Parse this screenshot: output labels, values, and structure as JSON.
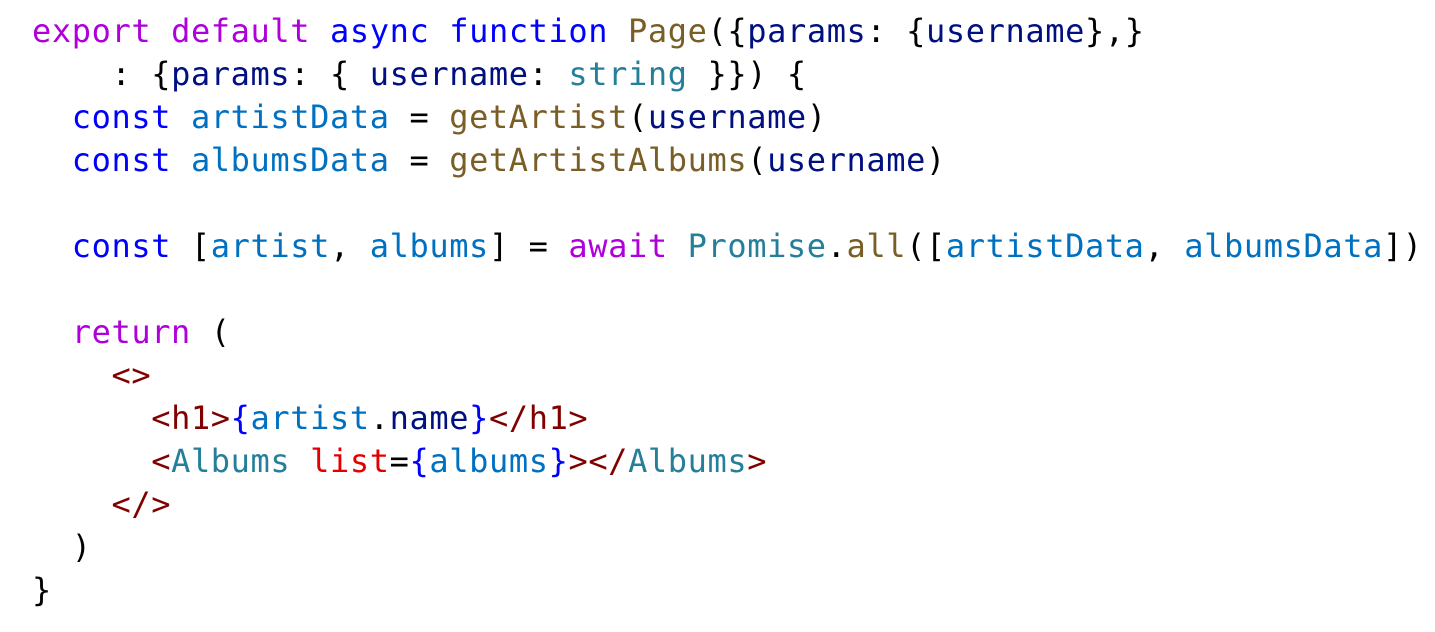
{
  "code": {
    "language": "tsx",
    "colors": {
      "kw": "#af00db",
      "st": "#0000ff",
      "fn": "#795e26",
      "pr": "#001080",
      "ty": "#267f99",
      "vr": "#0070c1",
      "tg": "#800000",
      "at": "#e50000",
      "br": "#0000ff",
      "pl": "#000000"
    },
    "lines": [
      {
        "tokens": [
          {
            "t": "export",
            "c": "kw"
          },
          {
            "t": " ",
            "c": "pl"
          },
          {
            "t": "default",
            "c": "kw"
          },
          {
            "t": " ",
            "c": "pl"
          },
          {
            "t": "async",
            "c": "st"
          },
          {
            "t": " ",
            "c": "pl"
          },
          {
            "t": "function",
            "c": "st"
          },
          {
            "t": " ",
            "c": "pl"
          },
          {
            "t": "Page",
            "c": "fn"
          },
          {
            "t": "({",
            "c": "pl"
          },
          {
            "t": "params",
            "c": "pr"
          },
          {
            "t": ": {",
            "c": "pl"
          },
          {
            "t": "username",
            "c": "pr"
          },
          {
            "t": "},}",
            "c": "pl"
          }
        ]
      },
      {
        "tokens": [
          {
            "t": "    : {",
            "c": "pl"
          },
          {
            "t": "params",
            "c": "pr"
          },
          {
            "t": ": { ",
            "c": "pl"
          },
          {
            "t": "username",
            "c": "pr"
          },
          {
            "t": ": ",
            "c": "pl"
          },
          {
            "t": "string",
            "c": "ty"
          },
          {
            "t": " }}) {",
            "c": "pl"
          }
        ]
      },
      {
        "tokens": [
          {
            "t": "  ",
            "c": "pl"
          },
          {
            "t": "const",
            "c": "st"
          },
          {
            "t": " ",
            "c": "pl"
          },
          {
            "t": "artistData",
            "c": "vr"
          },
          {
            "t": " = ",
            "c": "pl"
          },
          {
            "t": "getArtist",
            "c": "fn"
          },
          {
            "t": "(",
            "c": "pl"
          },
          {
            "t": "username",
            "c": "pr"
          },
          {
            "t": ")",
            "c": "pl"
          }
        ]
      },
      {
        "tokens": [
          {
            "t": "  ",
            "c": "pl"
          },
          {
            "t": "const",
            "c": "st"
          },
          {
            "t": " ",
            "c": "pl"
          },
          {
            "t": "albumsData",
            "c": "vr"
          },
          {
            "t": " = ",
            "c": "pl"
          },
          {
            "t": "getArtistAlbums",
            "c": "fn"
          },
          {
            "t": "(",
            "c": "pl"
          },
          {
            "t": "username",
            "c": "pr"
          },
          {
            "t": ")",
            "c": "pl"
          }
        ]
      },
      {
        "tokens": []
      },
      {
        "tokens": [
          {
            "t": "  ",
            "c": "pl"
          },
          {
            "t": "const",
            "c": "st"
          },
          {
            "t": " [",
            "c": "pl"
          },
          {
            "t": "artist",
            "c": "vr"
          },
          {
            "t": ", ",
            "c": "pl"
          },
          {
            "t": "albums",
            "c": "vr"
          },
          {
            "t": "] = ",
            "c": "pl"
          },
          {
            "t": "await",
            "c": "kw"
          },
          {
            "t": " ",
            "c": "pl"
          },
          {
            "t": "Promise",
            "c": "ty"
          },
          {
            "t": ".",
            "c": "pl"
          },
          {
            "t": "all",
            "c": "fn"
          },
          {
            "t": "([",
            "c": "pl"
          },
          {
            "t": "artistData",
            "c": "vr"
          },
          {
            "t": ", ",
            "c": "pl"
          },
          {
            "t": "albumsData",
            "c": "vr"
          },
          {
            "t": "])",
            "c": "pl"
          }
        ]
      },
      {
        "tokens": []
      },
      {
        "tokens": [
          {
            "t": "  ",
            "c": "pl"
          },
          {
            "t": "return",
            "c": "kw"
          },
          {
            "t": " (",
            "c": "pl"
          }
        ]
      },
      {
        "tokens": [
          {
            "t": "    ",
            "c": "pl"
          },
          {
            "t": "<>",
            "c": "tg"
          }
        ]
      },
      {
        "tokens": [
          {
            "t": "      ",
            "c": "pl"
          },
          {
            "t": "<h1>",
            "c": "tg"
          },
          {
            "t": "{",
            "c": "br"
          },
          {
            "t": "artist",
            "c": "vr"
          },
          {
            "t": ".",
            "c": "pl"
          },
          {
            "t": "name",
            "c": "pr"
          },
          {
            "t": "}",
            "c": "br"
          },
          {
            "t": "</h1>",
            "c": "tg"
          }
        ]
      },
      {
        "tokens": [
          {
            "t": "      ",
            "c": "pl"
          },
          {
            "t": "<",
            "c": "tg"
          },
          {
            "t": "Albums",
            "c": "ty"
          },
          {
            "t": " ",
            "c": "pl"
          },
          {
            "t": "list",
            "c": "at"
          },
          {
            "t": "=",
            "c": "pl"
          },
          {
            "t": "{",
            "c": "br"
          },
          {
            "t": "albums",
            "c": "vr"
          },
          {
            "t": "}",
            "c": "br"
          },
          {
            "t": "></",
            "c": "tg"
          },
          {
            "t": "Albums",
            "c": "ty"
          },
          {
            "t": ">",
            "c": "tg"
          }
        ]
      },
      {
        "tokens": [
          {
            "t": "    ",
            "c": "pl"
          },
          {
            "t": "</>",
            "c": "tg"
          }
        ]
      },
      {
        "tokens": [
          {
            "t": "  )",
            "c": "pl"
          }
        ]
      },
      {
        "tokens": [
          {
            "t": "}",
            "c": "pl"
          }
        ]
      }
    ]
  }
}
